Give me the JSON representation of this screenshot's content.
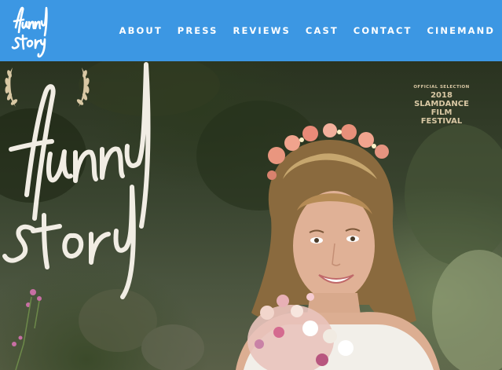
{
  "header": {
    "logo_text": "funny story",
    "nav": [
      {
        "label": "ABOUT"
      },
      {
        "label": "PRESS"
      },
      {
        "label": "REVIEWS"
      },
      {
        "label": "CAST"
      },
      {
        "label": "CONTACT"
      },
      {
        "label": "CINEMAND"
      }
    ]
  },
  "hero": {
    "title_art_text": "funny story",
    "laurel": {
      "line1": "OFFICIAL SELECTION",
      "line2": "2018 SLAMDANCE",
      "line3": "FILM FESTIVAL"
    }
  },
  "colors": {
    "header_bg": "#3c97e3",
    "nav_text": "#ffffff",
    "laurel_gold": "#d9c8a4"
  }
}
